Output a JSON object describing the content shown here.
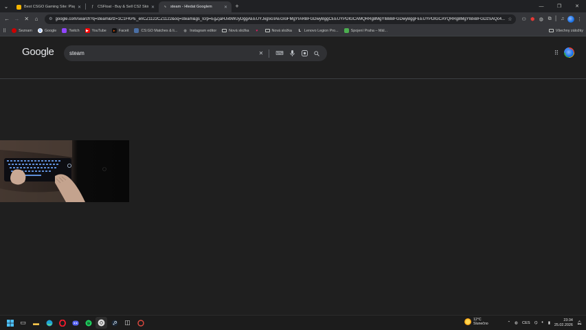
{
  "tabs": [
    {
      "title": "Best CSGO Gaming Site: Play &",
      "favicon_color": "#f4b400",
      "active": false
    },
    {
      "title": "CSFloat - Buy & Sell CS2 Skins",
      "favicon_color": "#9aa0a6",
      "active": false
    },
    {
      "title": "steam - Hledat Googlem",
      "favicon_color": "#4285f4",
      "active": true
    }
  ],
  "address_bar": {
    "url": "google.com/search?q=steam&rlz=1C1FKPE_enCZ1122CZ1122&oq=steam&gs_lcrp=EgZjaHJvbWUyDggAEEUYJxg5GIAEGIoFMgYIARBFGDwyBggCEEUYPDIGCAMQRRg8MgYIBBBFGDwyBggFEEUYPDIGCAYQRRg8MgYIBxBFGDzSAQc4..."
  },
  "bookmarks": [
    {
      "label": "Seznam",
      "color": "#cc0000"
    },
    {
      "label": "Google",
      "color": "#ffffff"
    },
    {
      "label": "Twitch",
      "color": "#9146ff"
    },
    {
      "label": "YouTube",
      "color": "#ff0000"
    },
    {
      "label": "Faceit",
      "color": "#ff5500"
    },
    {
      "label": "CS:GO Matches & li...",
      "color": "#4a6fa5"
    },
    {
      "label": "Instagram editor",
      "color": "#c4c7c5"
    },
    {
      "label": "Nová složka",
      "color": "#c4c7c5"
    },
    {
      "label": "",
      "color": "#e91e63"
    },
    {
      "label": "Nová složka",
      "color": "#c4c7c5"
    },
    {
      "label": "Lenovo Legion Pro...",
      "color": "#ffffff"
    },
    {
      "label": "Spojení Praha – Mál...",
      "color": "#4caf50"
    }
  ],
  "bookmarks_all": "Všechny záložky",
  "google": {
    "logo": "Google",
    "query": "steam"
  },
  "taskbar": {
    "weather_temp": "12°C",
    "weather_desc": "Slunečno",
    "language": "CES",
    "time": "23:34",
    "date": "25.02.2026"
  }
}
